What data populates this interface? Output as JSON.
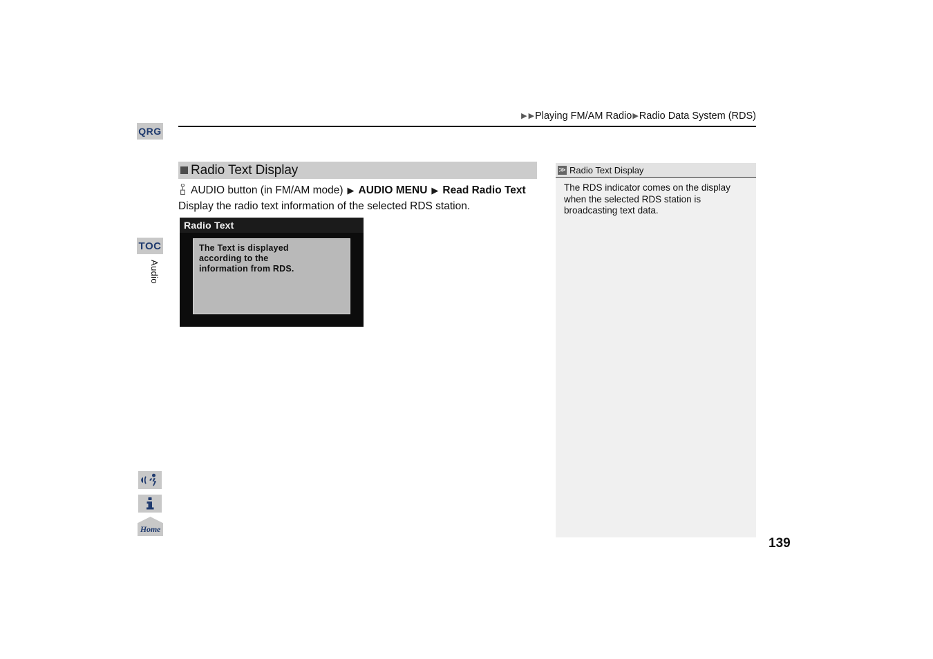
{
  "breadcrumb": {
    "arrow_glyph": "▶",
    "segment_1": "Playing FM/AM Radio",
    "segment_2": "Radio Data System (RDS)"
  },
  "left_rail": {
    "qrg_label": "QRG",
    "toc_label": "TOC",
    "chapter_tab_label": "Audio",
    "voice_icon_name": "voice-command-icon",
    "info_icon_name": "information-icon",
    "home_label": "Home"
  },
  "section": {
    "heading": "Radio Text Display",
    "command": {
      "press_icon_name": "button-press-icon",
      "step_1": "AUDIO button (in FM/AM mode)",
      "arrow": "▶",
      "step_2": "AUDIO MENU",
      "step_3": "Read Radio Text"
    },
    "description": "Display the radio text information of the selected RDS station."
  },
  "device_screenshot": {
    "title": "Radio Text",
    "body_line_1": "The Text is displayed",
    "body_line_2": "according to the",
    "body_line_3": "information from RDS."
  },
  "note": {
    "icon_glyph": "≫",
    "title": "Radio Text Display",
    "body": "The RDS indicator comes on the display when the selected RDS station is broadcasting text data."
  },
  "footer": {
    "page_number": "139"
  },
  "colors": {
    "accent_blue": "#1f3a6e",
    "rail_button_gray": "#c8c8c8",
    "heading_bar_gray": "#cccccc",
    "note_bg": "#f0f0f0",
    "note_header_bg": "#e2e2e2"
  }
}
